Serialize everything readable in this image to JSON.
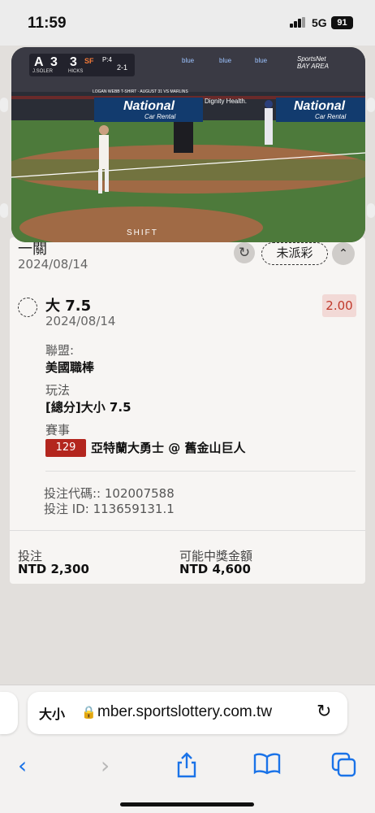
{
  "status_bar": {
    "time": "11:59",
    "network": "5G",
    "battery": "91"
  },
  "video": {
    "scorebug": {
      "away_team": "A",
      "away_score": "3",
      "home_score": "3",
      "home_team": "SF",
      "away_player": "J.SOLER",
      "home_player": "HICKS",
      "inning_info": "P:4",
      "count": "2-1"
    },
    "banner_text": "National",
    "banner_sub": "Car Rental",
    "sponsor_text": "Dignity Health.",
    "rail_text": "LOGAN WEBB T-SHIRT · AUGUST 31 VS MARLINS",
    "network_logo": "SportsNet BAY AREA",
    "mound_text": "SHIFT",
    "ad_text": "blue"
  },
  "bet_card": {
    "title": "一關",
    "date": "2024/08/14",
    "status": "未派彩",
    "pick": "大 7.5",
    "pick_date": "2024/08/14",
    "odds": "2.00",
    "league_label": "聯盟:",
    "league": "美國職棒",
    "market_label": "玩法",
    "market": "[總分]大小 7.5",
    "event_label": "賽事",
    "event_number": "129",
    "event": "亞特蘭大勇士 @ 舊金山巨人",
    "bet_code": "投注代碼:: 102007588",
    "bet_id": "投注 ID: 113659131.1",
    "stake_label": "投注",
    "stake": "NTD 2,300",
    "payout_label": "可能中獎金額",
    "payout": "NTD 4,600"
  },
  "browser": {
    "text_size_label": "大小",
    "url": "mber.sportslottery.com.tw",
    "icons": [
      "back-icon",
      "forward-icon",
      "share-icon",
      "bookmarks-icon",
      "tabs-icon"
    ]
  }
}
